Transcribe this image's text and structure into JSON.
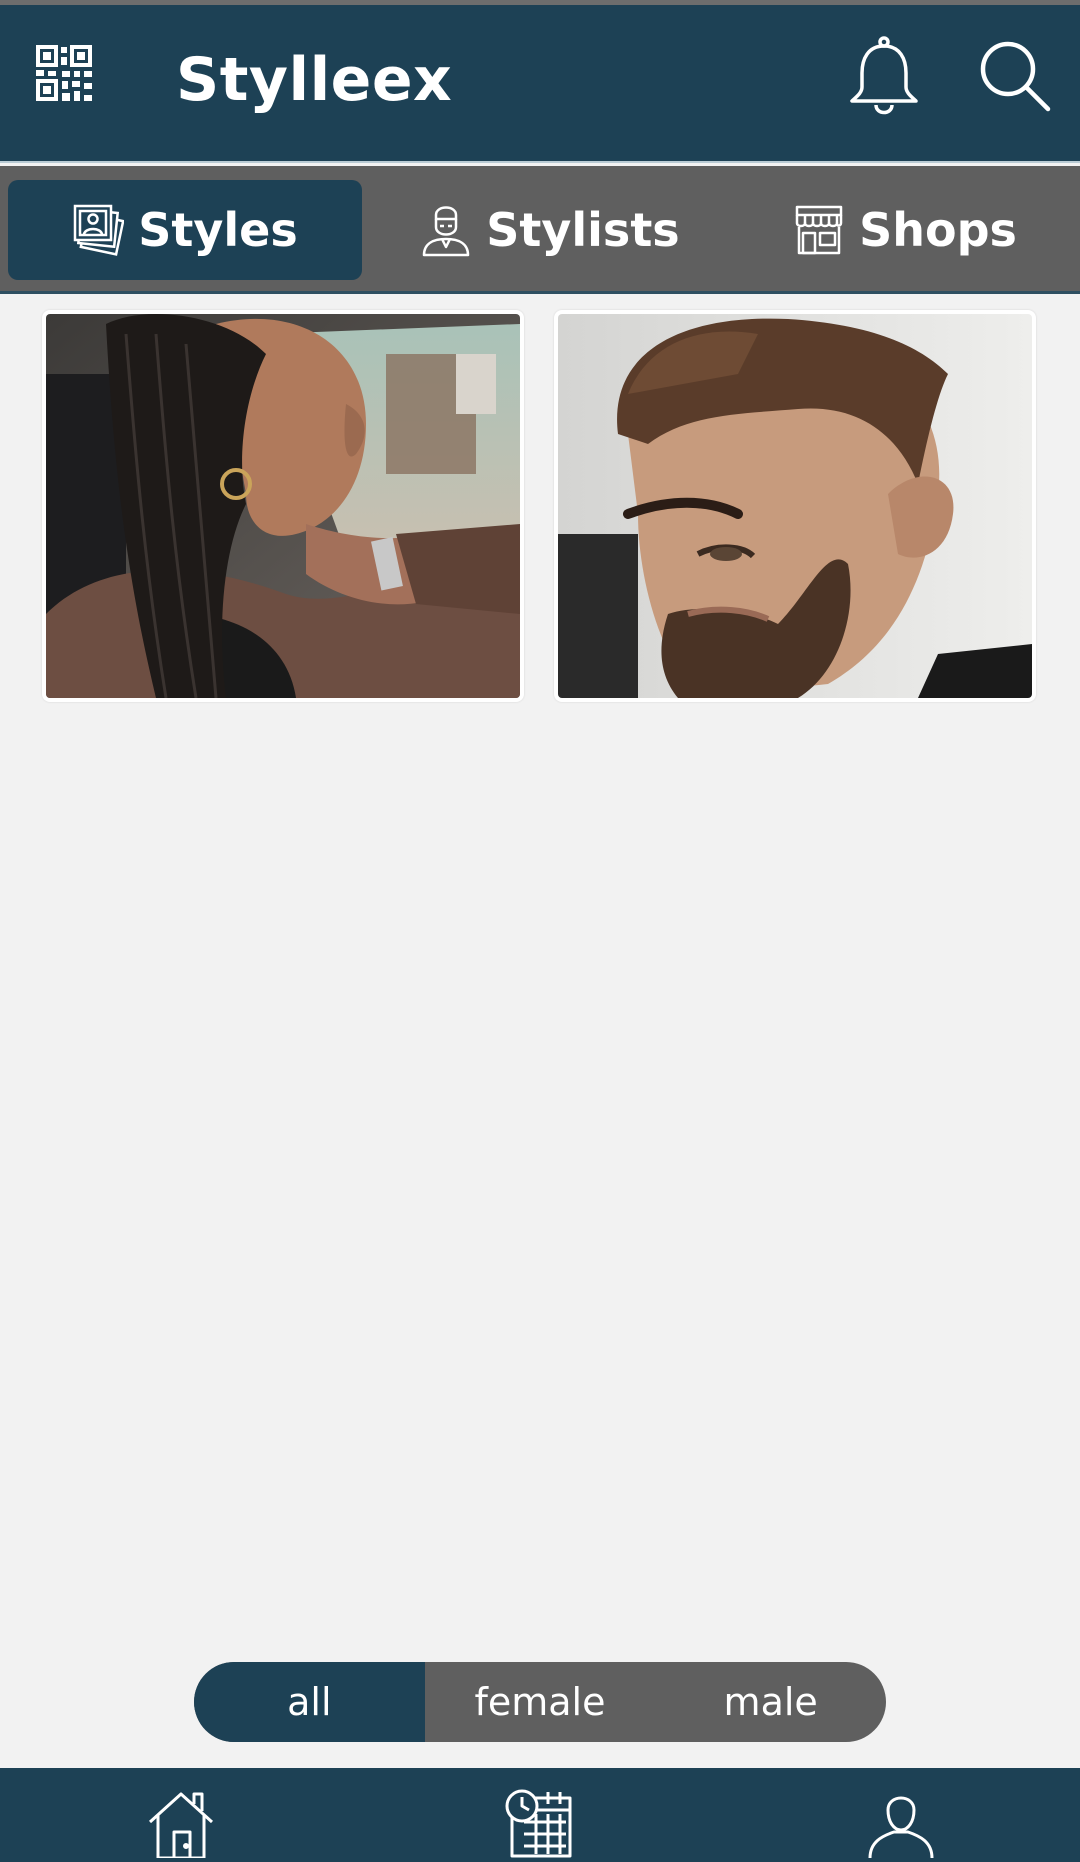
{
  "app": {
    "title": "Stylleex"
  },
  "tabs": [
    {
      "label": "Styles",
      "icon": "photo-stack-icon",
      "active": true
    },
    {
      "label": "Stylists",
      "icon": "stylist-person-icon",
      "active": false
    },
    {
      "label": "Shops",
      "icon": "storefront-icon",
      "active": false
    }
  ],
  "gallery": [
    {
      "subject": "woman-with-cornrow-braids"
    },
    {
      "subject": "man-with-fade-haircut"
    }
  ],
  "filter": {
    "options": [
      {
        "label": "all",
        "active": true
      },
      {
        "label": "female",
        "active": false
      },
      {
        "label": "male",
        "active": false
      }
    ]
  },
  "bottom_nav": [
    "home-icon",
    "calendar-clock-icon",
    "profile-icon"
  ],
  "colors": {
    "primary": "#1d4155",
    "tab_bar": "#5f5f5f",
    "background": "#f2f2f2"
  }
}
